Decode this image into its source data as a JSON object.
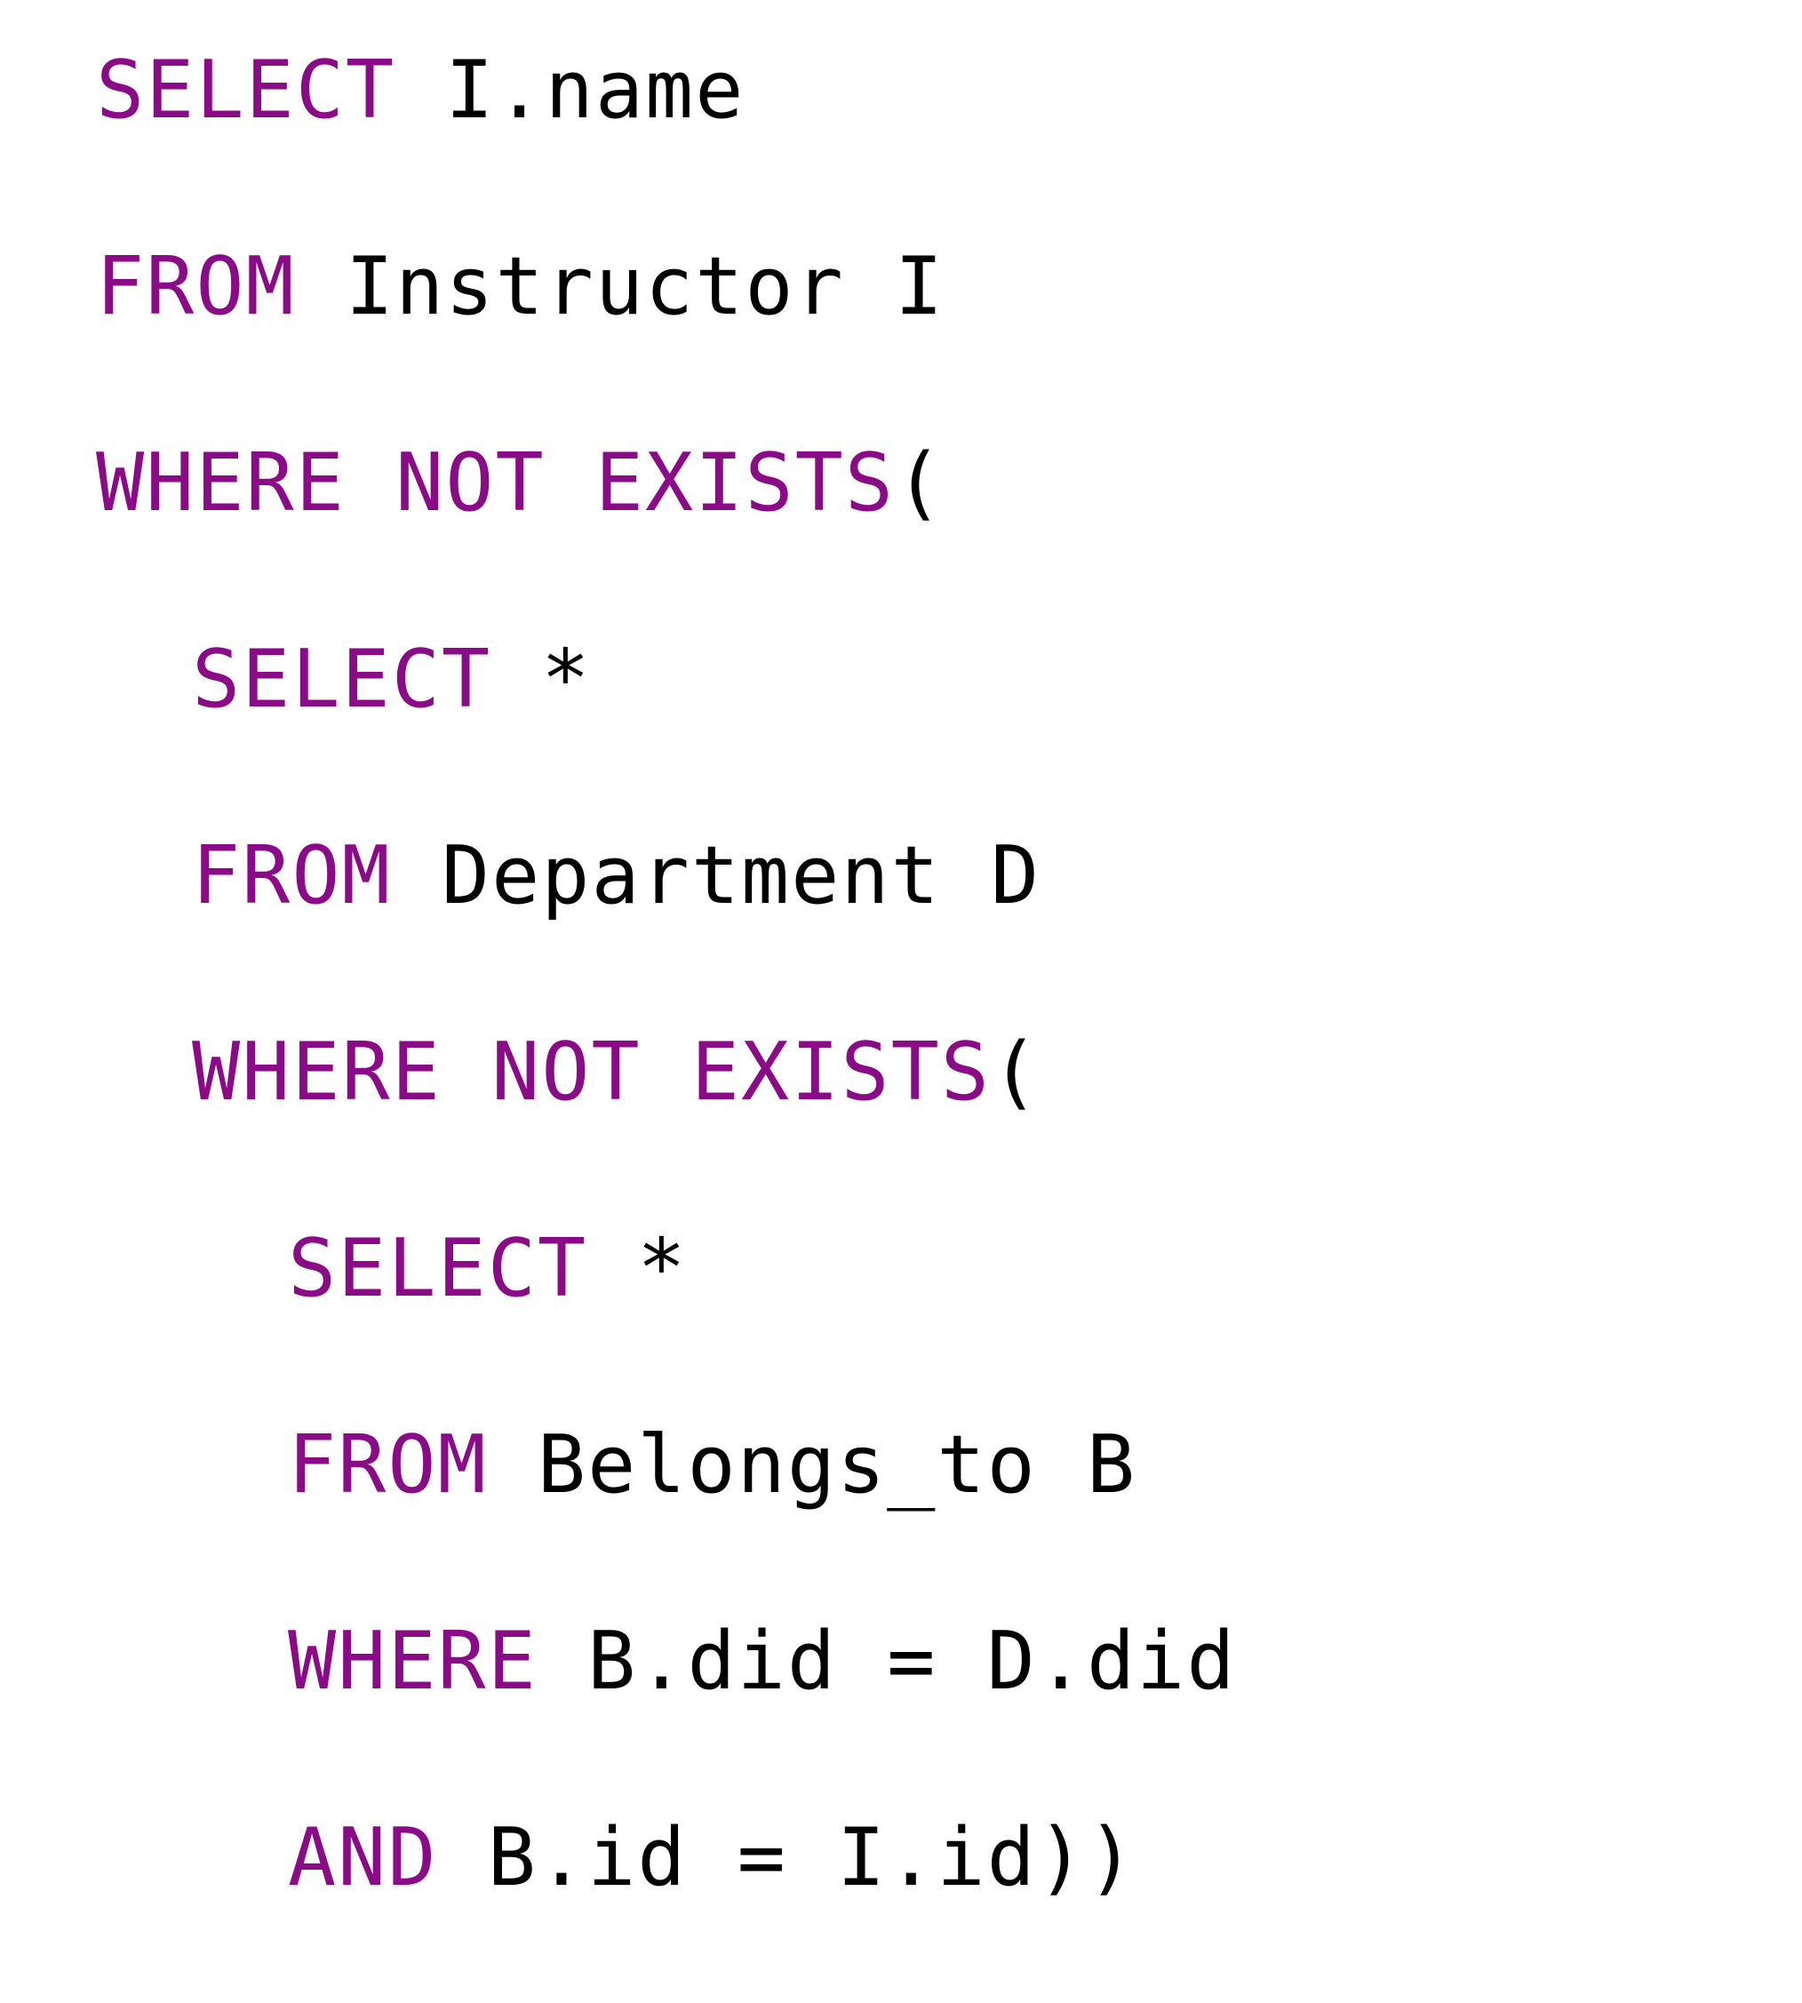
{
  "colors": {
    "keyword": "#8b0a88",
    "text": "#000000",
    "background": "#ffffff"
  },
  "code": {
    "lines": [
      {
        "indent": 0,
        "tokens": [
          {
            "kw": true,
            "text": "SELECT"
          },
          {
            "kw": false,
            "text": " I.name"
          }
        ]
      },
      {
        "indent": 0,
        "tokens": [
          {
            "kw": true,
            "text": "FROM"
          },
          {
            "kw": false,
            "text": " Instructor I"
          }
        ]
      },
      {
        "indent": 0,
        "tokens": [
          {
            "kw": true,
            "text": "WHERE NOT EXISTS"
          },
          {
            "kw": false,
            "text": "("
          }
        ]
      },
      {
        "indent": 1,
        "tokens": [
          {
            "kw": true,
            "text": "SELECT"
          },
          {
            "kw": false,
            "text": " *"
          }
        ]
      },
      {
        "indent": 1,
        "tokens": [
          {
            "kw": true,
            "text": "FROM"
          },
          {
            "kw": false,
            "text": " Department D"
          }
        ]
      },
      {
        "indent": 1,
        "tokens": [
          {
            "kw": true,
            "text": "WHERE NOT EXISTS"
          },
          {
            "kw": false,
            "text": "("
          }
        ]
      },
      {
        "indent": 2,
        "tokens": [
          {
            "kw": true,
            "text": "SELECT"
          },
          {
            "kw": false,
            "text": " *"
          }
        ]
      },
      {
        "indent": 2,
        "tokens": [
          {
            "kw": true,
            "text": "FROM"
          },
          {
            "kw": false,
            "text": " Belongs_to B"
          }
        ]
      },
      {
        "indent": 2,
        "tokens": [
          {
            "kw": true,
            "text": "WHERE"
          },
          {
            "kw": false,
            "text": " B.did = D.did"
          }
        ]
      },
      {
        "indent": 2,
        "tokens": [
          {
            "kw": true,
            "text": "AND"
          },
          {
            "kw": false,
            "text": " B.id = I.id))"
          }
        ]
      }
    ]
  }
}
